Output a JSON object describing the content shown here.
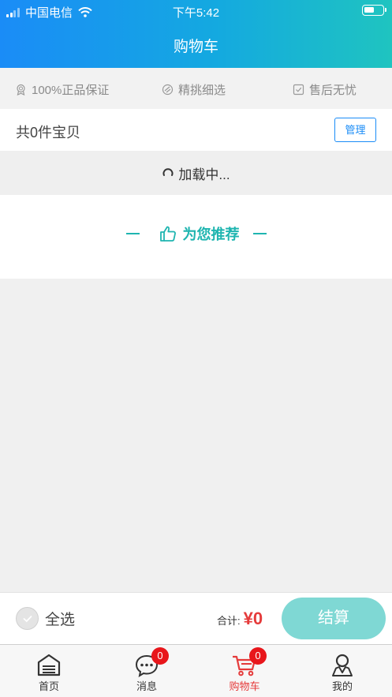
{
  "statusbar": {
    "carrier": "中国电信",
    "time": "下午5:42"
  },
  "header": {
    "title": "购物车"
  },
  "guarantees": [
    {
      "label": "100%正品保证",
      "icon": "medal-icon"
    },
    {
      "label": "精挑细选",
      "icon": "diamond-icon"
    },
    {
      "label": "售后无忧",
      "icon": "checkbox-icon"
    }
  ],
  "cart": {
    "count_text": "共0件宝贝",
    "manage_label": "管理"
  },
  "loading": {
    "text": "加载中..."
  },
  "recommend": {
    "title": "为您推荐",
    "icon": "thumbs-up-icon"
  },
  "checkout": {
    "select_all_label": "全选",
    "total_label": "合计:",
    "total_value": "¥0",
    "pay_label": "结算"
  },
  "tabs": [
    {
      "label": "首页",
      "icon": "home-icon"
    },
    {
      "label": "消息",
      "icon": "message-icon",
      "badge": "0"
    },
    {
      "label": "购物车",
      "icon": "cart-icon",
      "badge": "0",
      "active": true
    },
    {
      "label": "我的",
      "icon": "user-icon"
    }
  ],
  "colors": {
    "accent": "#1fb5b0",
    "header_start": "#1a8cf7",
    "header_end": "#1fc4c0",
    "price": "#e53b3b",
    "pay_button": "#7fd8d4",
    "badge": "#e8161b"
  }
}
